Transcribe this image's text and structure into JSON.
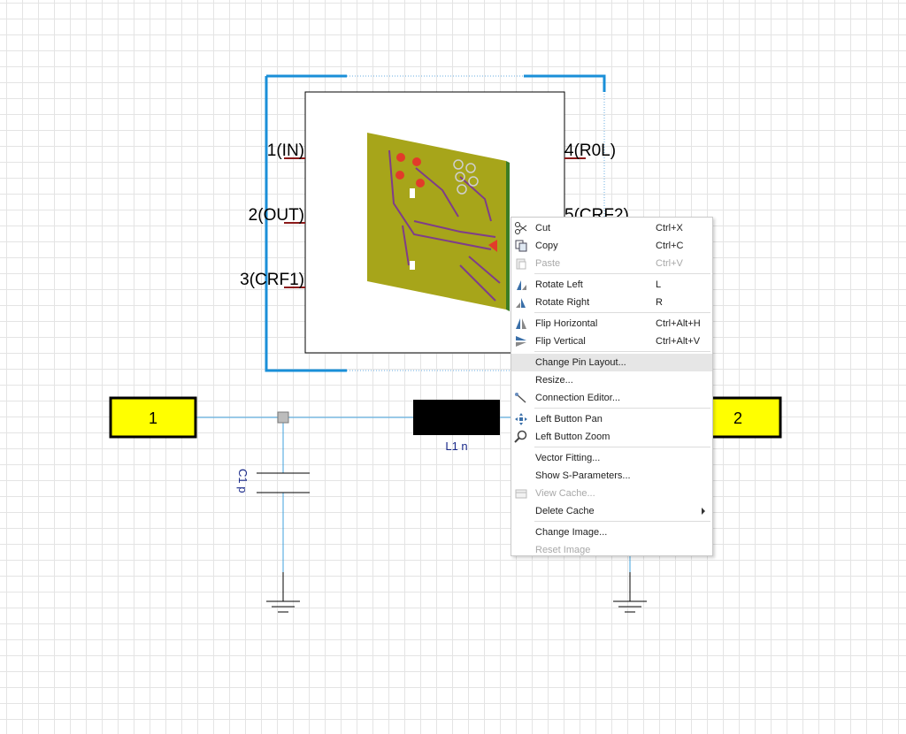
{
  "schematic": {
    "block_pins": [
      "1(IN)",
      "2(OUT)",
      "3(CRF1)",
      "4(R0L)",
      "5(CRF2)"
    ],
    "port_left": "1",
    "port_right": "2",
    "inductor_label": "L1 n",
    "capacitor_label": "C1 p"
  },
  "context_menu": {
    "items": [
      {
        "label": "Cut",
        "shortcut": "Ctrl+X",
        "icon": "scissors-icon",
        "enabled": true
      },
      {
        "label": "Copy",
        "shortcut": "Ctrl+C",
        "icon": "copy-icon",
        "enabled": true
      },
      {
        "label": "Paste",
        "shortcut": "Ctrl+V",
        "icon": "paste-icon",
        "enabled": false
      },
      {
        "label": "Rotate Left",
        "shortcut": "L",
        "icon": "rotate-left-icon",
        "enabled": true
      },
      {
        "label": "Rotate Right",
        "shortcut": "R",
        "icon": "rotate-right-icon",
        "enabled": true
      },
      {
        "label": "Flip Horizontal",
        "shortcut": "Ctrl+Alt+H",
        "icon": "flip-horizontal-icon",
        "enabled": true
      },
      {
        "label": "Flip Vertical",
        "shortcut": "Ctrl+Alt+V",
        "icon": "flip-vertical-icon",
        "enabled": true
      },
      {
        "label": "Change Pin Layout...",
        "shortcut": "",
        "icon": "",
        "enabled": true,
        "highlighted": true
      },
      {
        "label": "Resize...",
        "shortcut": "",
        "icon": "",
        "enabled": true
      },
      {
        "label": "Connection Editor...",
        "shortcut": "",
        "icon": "connection-editor-icon",
        "enabled": true
      },
      {
        "label": "Left Button Pan",
        "shortcut": "",
        "icon": "pan-icon",
        "enabled": true
      },
      {
        "label": "Left Button Zoom",
        "shortcut": "",
        "icon": "zoom-icon",
        "enabled": true
      },
      {
        "label": "Vector Fitting...",
        "shortcut": "",
        "icon": "",
        "enabled": true
      },
      {
        "label": "Show S-Parameters...",
        "shortcut": "",
        "icon": "",
        "enabled": true
      },
      {
        "label": "View Cache...",
        "shortcut": "",
        "icon": "view-cache-icon",
        "enabled": false
      },
      {
        "label": "Delete Cache",
        "shortcut": "",
        "icon": "",
        "enabled": true,
        "submenu": true
      },
      {
        "label": "Change Image...",
        "shortcut": "",
        "icon": "",
        "enabled": true
      },
      {
        "label": "Reset Image",
        "shortcut": "",
        "icon": "",
        "enabled": false
      }
    ]
  },
  "colors": {
    "selection": "#1a8fd8",
    "wire": "#3fa0dc",
    "port_fill": "#ffff00",
    "pcb": "#a7a51a",
    "pin_stub": "#8b1a1a"
  }
}
